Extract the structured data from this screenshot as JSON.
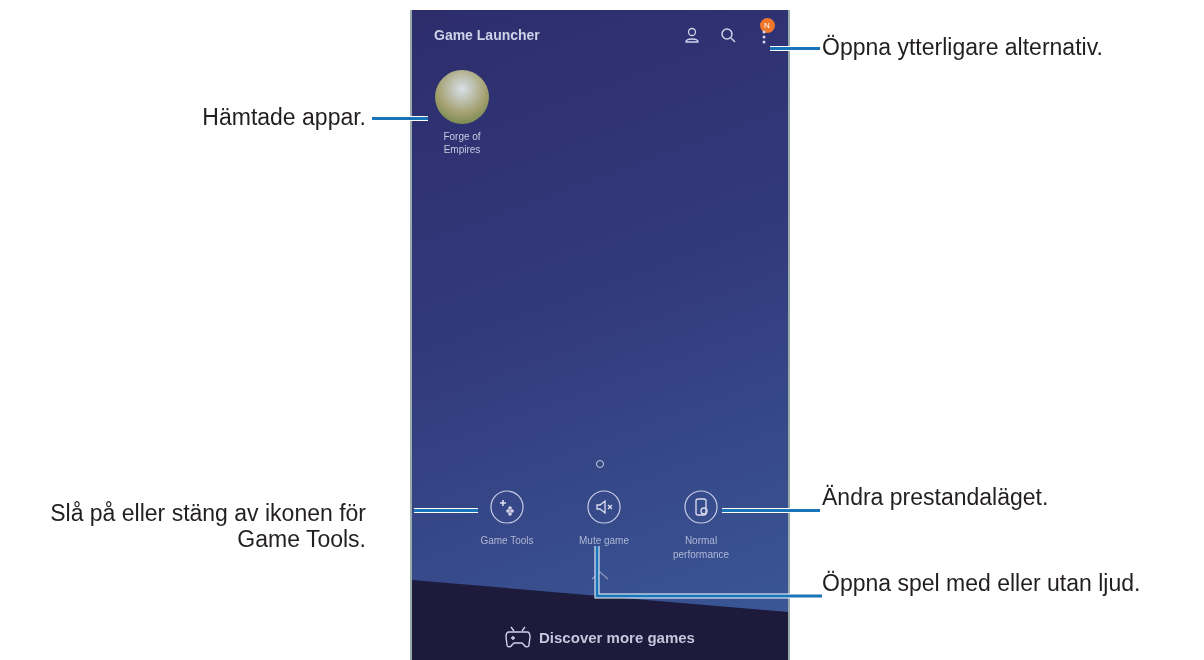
{
  "screen": {
    "title": "Game Launcher",
    "badge": "N",
    "apps": [
      {
        "label": "Forge of Empires"
      }
    ],
    "tools": [
      {
        "kind": "game-tools",
        "label": "Game Tools"
      },
      {
        "kind": "mute",
        "label": "Mute game"
      },
      {
        "kind": "performance",
        "label": "Normal performance"
      }
    ],
    "discover": "Discover more games"
  },
  "callouts_left": [
    "Hämtade appar.",
    "Slå på eller stäng av ikonen för\nGame Tools."
  ],
  "callouts_right": [
    "Öppna ytterligare alternativ.",
    "Ändra prestandaläget.",
    "Öppna spel med eller utan ljud."
  ]
}
